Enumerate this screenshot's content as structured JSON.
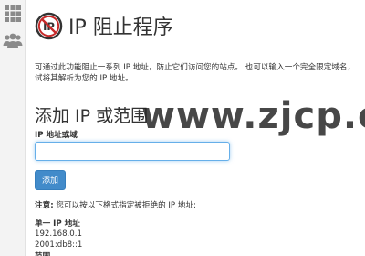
{
  "sidebar": {
    "icons": [
      "grid-icon",
      "users-icon"
    ]
  },
  "header": {
    "icon": "block-ip-icon",
    "icon_text": "IP",
    "title": "IP 阻止程序"
  },
  "description": {
    "line1": "可通过此功能阻止一系列 IP 地址，防止它们访问您的站点。 也可以输入一个完全限定域名，",
    "line2": "试将其解析为您的 IP 地址。"
  },
  "add_section": {
    "title": "添加 IP 或范围",
    "field_label": "IP 地址或域",
    "input_value": "",
    "button_label": "添加"
  },
  "notes": {
    "note_label": "注意:",
    "note_text": " 您可以按以下格式指定被拒绝的 IP 地址:",
    "single_heading": "单一 IP 地址",
    "example_ipv4": "192.168.0.1",
    "example_ipv6": "2001:db8::1",
    "range_heading": "范围"
  },
  "watermark": {
    "text": "www.zjcp.com"
  },
  "colors": {
    "accent": "#428bca",
    "sidebar_bg": "#f3f3f3",
    "icon_red": "#c62828",
    "icon_gray": "#8a8a8a"
  }
}
